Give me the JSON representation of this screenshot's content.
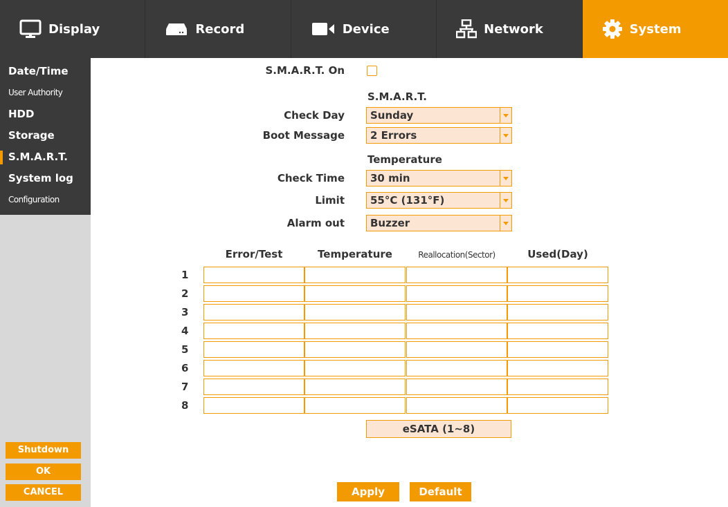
{
  "tabs": [
    {
      "label": "Display",
      "icon": "monitor-icon"
    },
    {
      "label": "Record",
      "icon": "recorder-icon"
    },
    {
      "label": "Device",
      "icon": "camera-icon"
    },
    {
      "label": "Network",
      "icon": "network-icon"
    },
    {
      "label": "System",
      "icon": "gear-icon"
    }
  ],
  "sidebar": {
    "items": [
      "Date/Time",
      "User Authority",
      "HDD",
      "Storage",
      "S.M.A.R.T.",
      "System log",
      "Configuration"
    ],
    "active_index": 4,
    "shutdown": "Shutdown",
    "ok": "OK",
    "cancel": "CANCEL"
  },
  "form": {
    "smart_on_label": "S.M.A.R.T. On",
    "smart_on_checked": false,
    "smart_section": "S.M.A.R.T.",
    "check_day_label": "Check Day",
    "check_day_value": "Sunday",
    "boot_message_label": "Boot Message",
    "boot_message_value": "2 Errors",
    "temperature_section": "Temperature",
    "check_time_label": "Check Time",
    "check_time_value": "30 min",
    "limit_label": "Limit",
    "limit_value": "55°C (131°F)",
    "alarm_out_label": "Alarm out",
    "alarm_out_value": "Buzzer"
  },
  "table": {
    "headers": [
      "Error/Test",
      "Temperature",
      "Reallocation(Sector)",
      "Used(Day)"
    ],
    "rows": [
      "1",
      "2",
      "3",
      "4",
      "5",
      "6",
      "7",
      "8"
    ]
  },
  "esata_label": "eSATA (1~8)",
  "buttons": {
    "apply": "Apply",
    "default": "Default"
  },
  "colors": {
    "accent": "#f29a00",
    "dark": "#3a3a3a",
    "field_bg": "#fde5d4"
  }
}
